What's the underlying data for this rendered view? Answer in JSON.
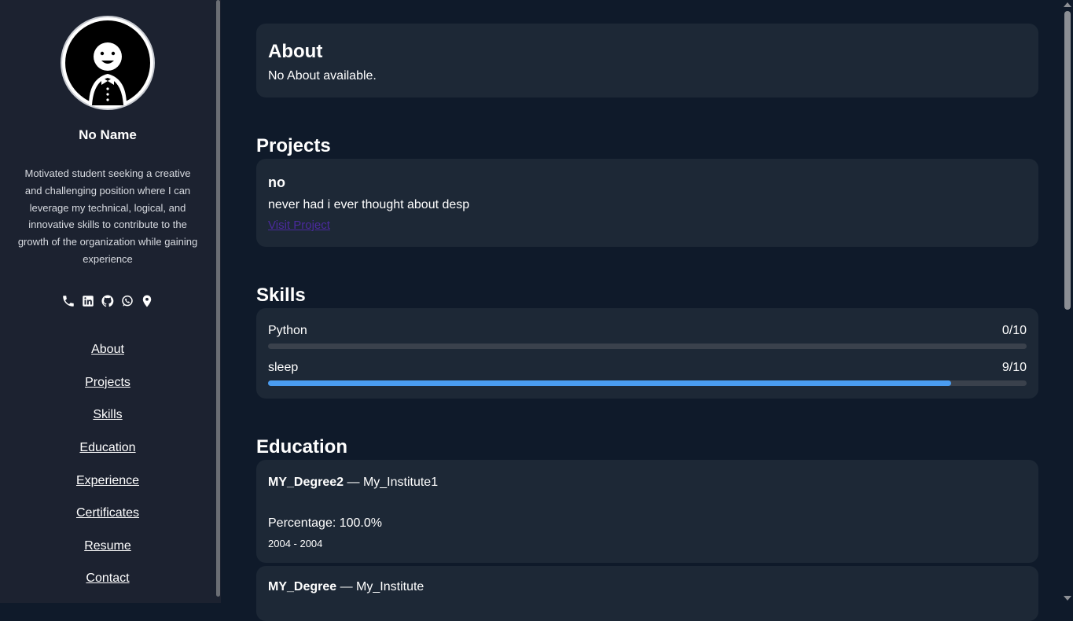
{
  "profile": {
    "name": "No Name",
    "bio": "Motivated student seeking a creative and challenging position where I can leverage my technical, logical, and innovative skills to contribute to the growth of the organization while gaining experience",
    "social_icons": [
      "phone-icon",
      "linkedin-icon",
      "github-icon",
      "whatsapp-icon",
      "location-icon"
    ]
  },
  "nav": {
    "items": [
      {
        "label": "About"
      },
      {
        "label": "Projects"
      },
      {
        "label": "Skills"
      },
      {
        "label": "Education"
      },
      {
        "label": "Experience"
      },
      {
        "label": "Certificates"
      },
      {
        "label": "Resume"
      },
      {
        "label": "Contact"
      }
    ]
  },
  "about": {
    "title": "About",
    "text": "No About available."
  },
  "projects": {
    "title": "Projects",
    "items": [
      {
        "name": "no",
        "description": "never had i ever thought about desp",
        "link_label": "Visit Project"
      }
    ]
  },
  "skills": {
    "title": "Skills",
    "items": [
      {
        "name": "Python",
        "score": "0/10",
        "level": 0
      },
      {
        "name": "sleep",
        "score": "9/10",
        "level": 0.9
      }
    ]
  },
  "education": {
    "title": "Education",
    "items": [
      {
        "degree": "MY_Degree2",
        "separator": " — ",
        "institute": "My_Institute1",
        "percentage": "Percentage: 100.0%",
        "years": "2004 - 2004"
      },
      {
        "degree": "MY_Degree",
        "separator": " — ",
        "institute": "My_Institute"
      }
    ]
  },
  "colors": {
    "background": "#0f1a2a",
    "sidebar": "#1c2230",
    "card": "#1d2836",
    "accent": "#4a9cf0",
    "link": "#4b2a9e"
  }
}
